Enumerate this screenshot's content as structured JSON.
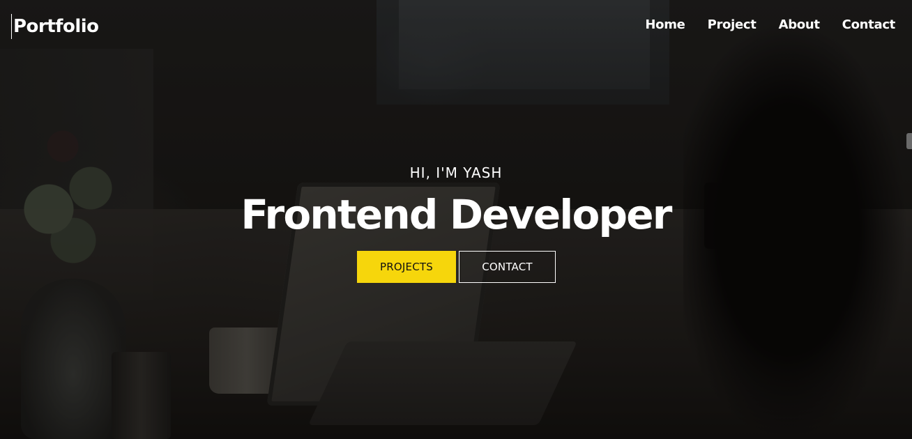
{
  "navbar": {
    "logo": "Portfolio",
    "links": [
      "Home",
      "Project",
      "About",
      "Contact"
    ]
  },
  "hero": {
    "greeting": "HI, I'M YASH",
    "title": "Frontend Developer",
    "primary_button": "PROJECTS",
    "secondary_button": "CONTACT"
  },
  "colors": {
    "accent": "#f6d60c",
    "text": "#ffffff",
    "overlay": "rgba(0,0,0,0.42)"
  }
}
